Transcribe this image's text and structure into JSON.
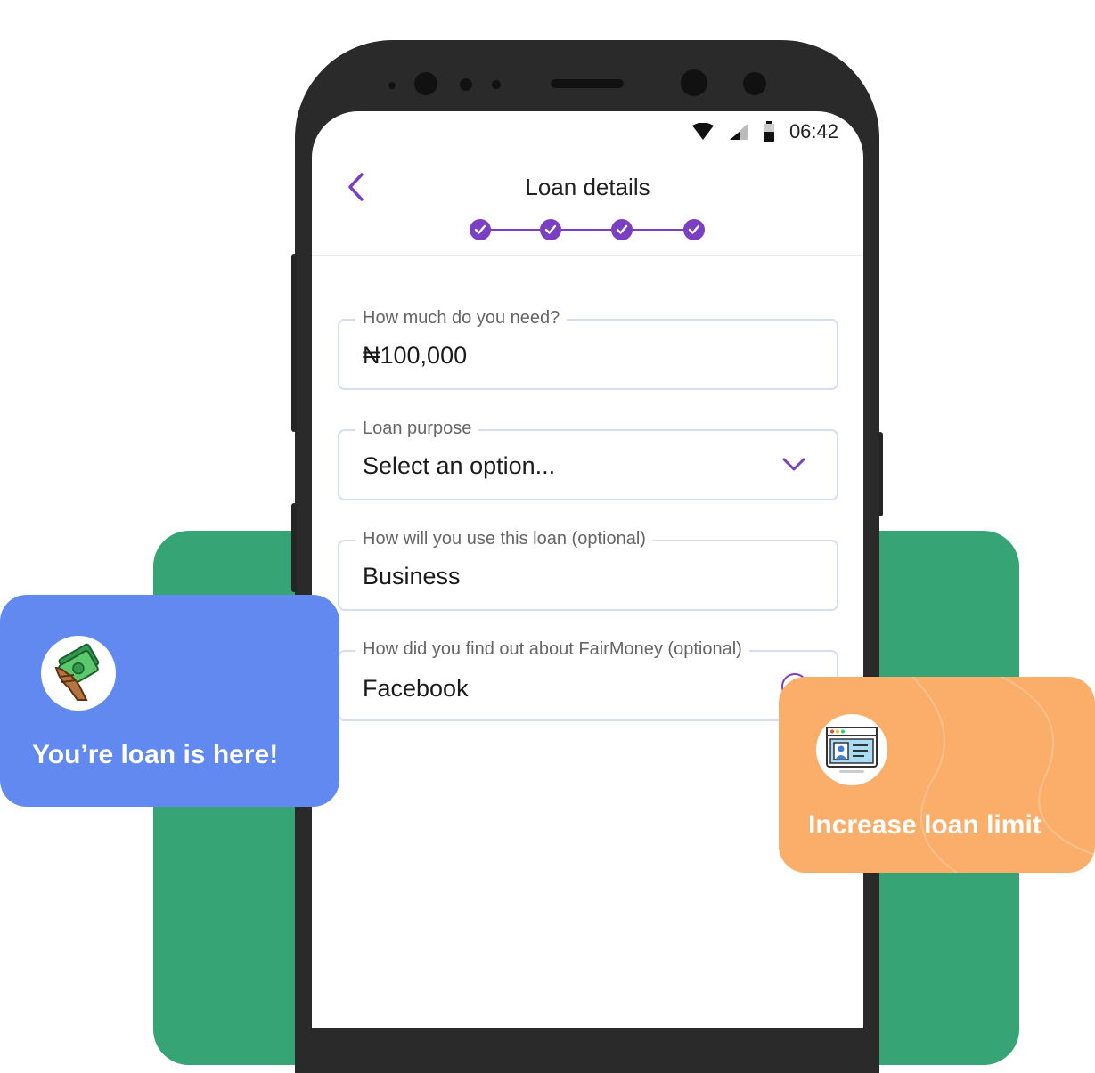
{
  "status_bar": {
    "time": "06:42"
  },
  "header": {
    "title": "Loan details",
    "steps_completed": 4
  },
  "form": {
    "amount": {
      "label": "How much do you need?",
      "value": "₦100,000"
    },
    "purpose": {
      "label": "Loan purpose",
      "value": "Select an option..."
    },
    "usage": {
      "label": "How will you use this loan (optional)",
      "value": "Business"
    },
    "source": {
      "label": "How did you find out about FairMoney (optional)",
      "value": "Facebook"
    }
  },
  "cards": {
    "blue": {
      "text": "You’re loan is here!",
      "icon": "money-hand-icon"
    },
    "orange": {
      "text": "Increase loan limit",
      "icon": "id-card-icon"
    }
  },
  "colors": {
    "accent": "#7b3fc4",
    "green": "#36a474",
    "blue_card": "#6289ef",
    "orange_card": "#fbae69"
  }
}
